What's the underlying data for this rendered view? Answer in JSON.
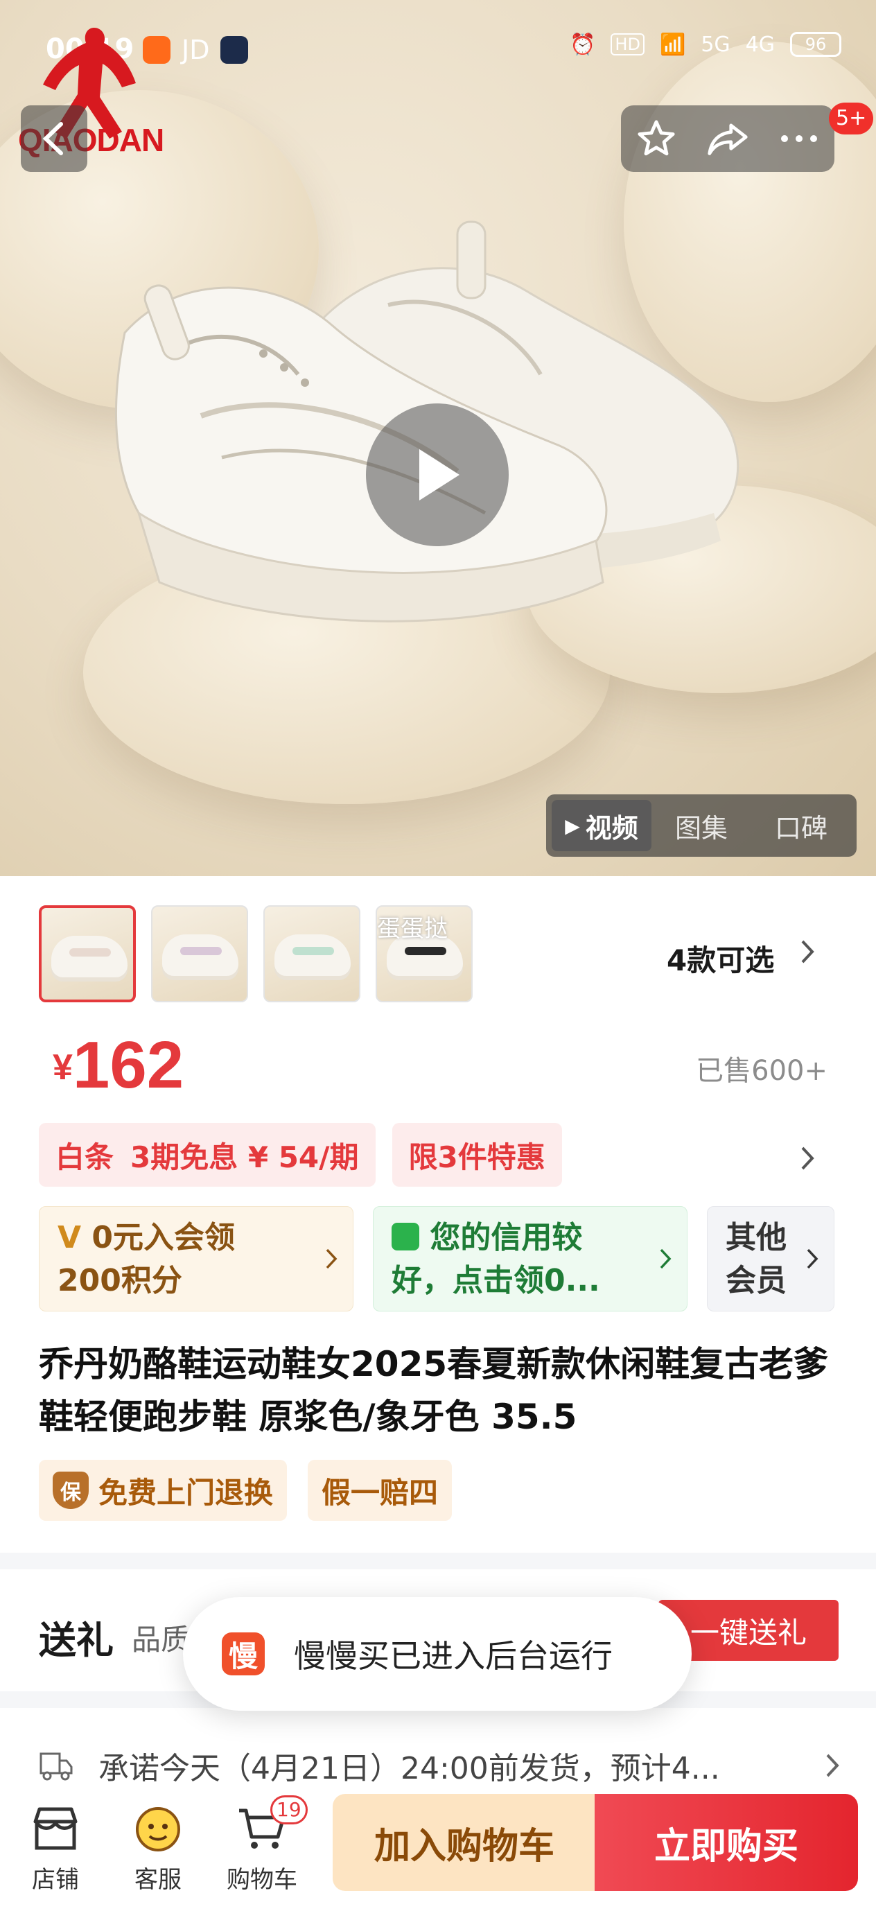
{
  "status_bar": {
    "time": "00:19",
    "jd_label": "JD",
    "network_5g": "5G",
    "network_4g": "4G",
    "battery": "96"
  },
  "brand": {
    "logo_text": "QIAODAN"
  },
  "header": {
    "cart_badge": "5+"
  },
  "media_tabs": [
    {
      "label": "视频",
      "active": true
    },
    {
      "label": "图集",
      "active": false
    },
    {
      "label": "口碑",
      "active": false
    }
  ],
  "variants": {
    "thumb_count": 4,
    "thumb_overlay_text": "蛋蛋挞",
    "styles_label": "4款可选"
  },
  "price": {
    "currency": "¥",
    "amount": "162",
    "sold": "已售600+"
  },
  "promos": {
    "baitiao": "白条",
    "installment": "3期免息 ¥ 54/期",
    "limit_offer": "限3件特惠"
  },
  "cards": {
    "member_line1": "0元入会领",
    "member_line2": "200积分",
    "credit_line1": "您的信用较",
    "credit_line2": "好，点击领0...",
    "other_line1": "其他",
    "other_line2": "会员"
  },
  "product": {
    "title": "乔丹奶酪鞋运动鞋女2025春夏新款休闲鞋复古老爹鞋轻便跑步鞋 原浆色/象牙色 35.5"
  },
  "service_tags": {
    "return_label": "免费上门退换",
    "return_icon_text": "保",
    "fake_label": "假一赔四"
  },
  "gift": {
    "title": "送礼",
    "subtitle": "品质",
    "button": "一键送礼"
  },
  "toast": {
    "icon_text": "慢",
    "message": "慢慢买已进入后台运行"
  },
  "shipping": {
    "text": "承诺今天（4月21日）24:00前发货，预计4..."
  },
  "bottom_nav": {
    "store": "店铺",
    "service": "客服",
    "cart": "购物车",
    "cart_count": "19",
    "add_to_cart": "加入购物车",
    "buy_now": "立即购买"
  },
  "colors": {
    "accent_red": "#e4393c",
    "member_gold": "#8a5313",
    "credit_green": "#1e7c36"
  }
}
